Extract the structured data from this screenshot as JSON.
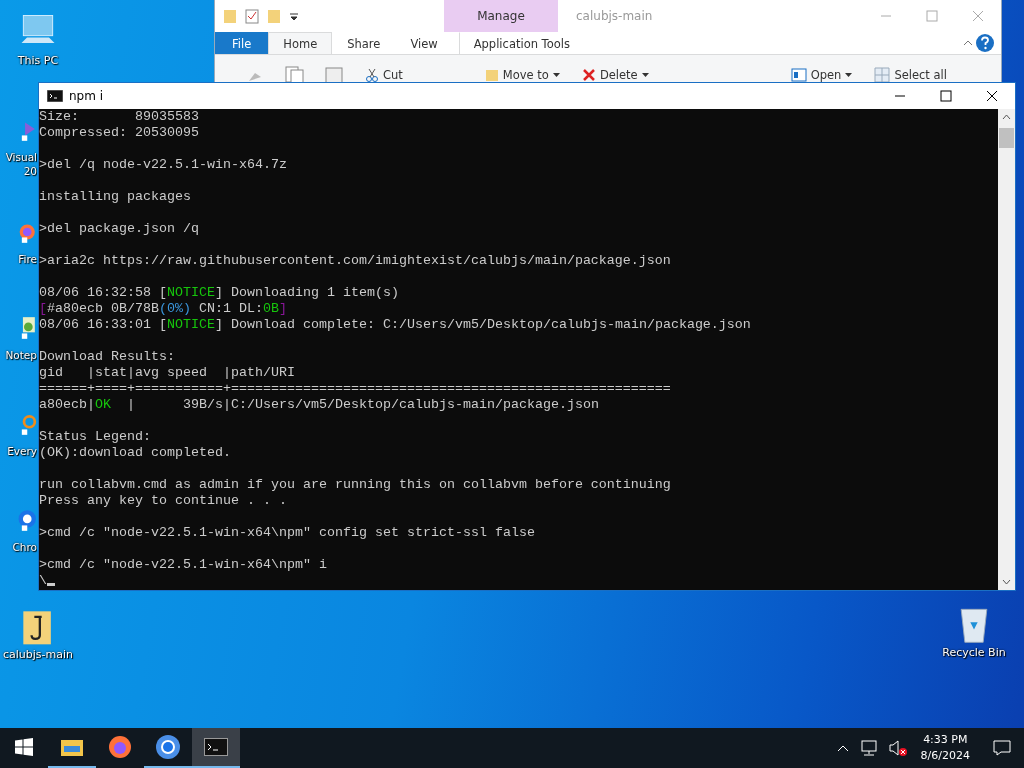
{
  "desktop": {
    "left_icons": [
      {
        "kind": "computer",
        "lines": [
          "This PC"
        ]
      },
      {
        "kind": "vs",
        "lines": [
          "Visual",
          "20"
        ]
      },
      {
        "kind": "firefox",
        "lines": [
          "Fire"
        ]
      },
      {
        "kind": "notepad",
        "lines": [
          "Notep"
        ]
      },
      {
        "kind": "everything",
        "lines": [
          "Every"
        ]
      },
      {
        "kind": "chrome",
        "lines": [
          "Chro"
        ]
      },
      {
        "kind": "folder",
        "lines": [
          "calubjs-main"
        ]
      }
    ],
    "right_icons": [
      {
        "kind": "recycle",
        "lines": [
          "Recycle Bin"
        ]
      }
    ]
  },
  "explorer": {
    "title": "calubjs-main",
    "context_label": "Manage",
    "tabs": [
      {
        "label": "File",
        "kind": "file",
        "selected": false
      },
      {
        "label": "Home",
        "kind": "plain",
        "selected": true
      },
      {
        "label": "Share",
        "kind": "plain",
        "selected": false
      },
      {
        "label": "View",
        "kind": "plain",
        "selected": false
      },
      {
        "label": "Application Tools",
        "kind": "context",
        "selected": false
      }
    ],
    "ribbon": [
      {
        "label": "Cut",
        "kind": "scissors",
        "dropdown": false
      },
      {
        "label": "Move to",
        "kind": "folder",
        "dropdown": true
      },
      {
        "label": "Delete",
        "kind": "delete",
        "dropdown": true
      },
      {
        "label": "Open",
        "kind": "open",
        "dropdown": true
      },
      {
        "label": "Select all",
        "kind": "grid",
        "dropdown": false
      }
    ]
  },
  "console": {
    "title": "npm i",
    "cursor": true,
    "blocks": [
      [
        [
          {
            "text": "Size:       89035583"
          }
        ],
        [
          {
            "text": "Compressed: 20530095"
          }
        ]
      ],
      [
        [
          {
            "text": ">del /q node-v22.5.1-win-x64.7z"
          }
        ]
      ],
      [
        [
          {
            "text": "installing packages"
          }
        ]
      ],
      [
        [
          {
            "text": ">del package.json /q"
          }
        ]
      ],
      [
        [
          {
            "text": ">aria2c https://raw.githubusercontent.com/imightexist/calubjs/main/package.json"
          }
        ]
      ],
      [
        [
          {
            "text": "08/06 16:32:58 ["
          },
          {
            "text": "NOTICE",
            "color": "#16c60c"
          },
          {
            "text": "] Downloading 1 item(s)"
          }
        ],
        [
          {
            "text": "[",
            "color": "#881798"
          },
          {
            "text": "#a80ecb 0B/78B"
          },
          {
            "text": "(0%)",
            "color": "#3a96dd"
          },
          {
            "text": " CN:1 DL:"
          },
          {
            "text": "0B",
            "color": "#16c60c"
          },
          {
            "text": "]",
            "color": "#881798"
          }
        ],
        [
          {
            "text": "08/06 16:33:01 ["
          },
          {
            "text": "NOTICE",
            "color": "#16c60c"
          },
          {
            "text": "] Download complete: C:/Users/vm5/Desktop/calubjs-main/package.json"
          }
        ]
      ],
      [
        [
          {
            "text": "Download Results:"
          }
        ],
        [
          {
            "text": "gid   |stat|avg speed  |path/URI"
          }
        ],
        [
          {
            "text": "======+====+===========+======================================================="
          }
        ],
        [
          {
            "text": "a80ecb|"
          },
          {
            "text": "OK",
            "color": "#16c60c"
          },
          {
            "text": "  |      39B/s|C:/Users/vm5/Desktop/calubjs-main/package.json"
          }
        ]
      ],
      [
        [
          {
            "text": "Status Legend:"
          }
        ],
        [
          {
            "text": "(OK):download completed."
          }
        ]
      ],
      [
        [
          {
            "text": "run collabvm.cmd as admin if you are running this on collabvm before continuing"
          }
        ],
        [
          {
            "text": "Press any key to continue . . ."
          }
        ]
      ],
      [
        [
          {
            "text": ">cmd /c \"node-v22.5.1-win-x64\\npm\" config set strict-ssl false"
          }
        ]
      ],
      [
        [
          {
            "text": ">cmd /c \"node-v22.5.1-win-x64\\npm\" i"
          }
        ],
        [
          {
            "text": "\\"
          }
        ]
      ]
    ]
  },
  "taskbar": {
    "apps": [
      {
        "kind": "explorer",
        "running": true,
        "selected": false
      },
      {
        "kind": "firefox",
        "running": false,
        "selected": false
      },
      {
        "kind": "chrome",
        "running": true,
        "selected": false
      },
      {
        "kind": "terminal",
        "running": true,
        "selected": true
      }
    ],
    "volume_muted": true,
    "time": "4:33 PM",
    "date": "8/6/2024"
  }
}
